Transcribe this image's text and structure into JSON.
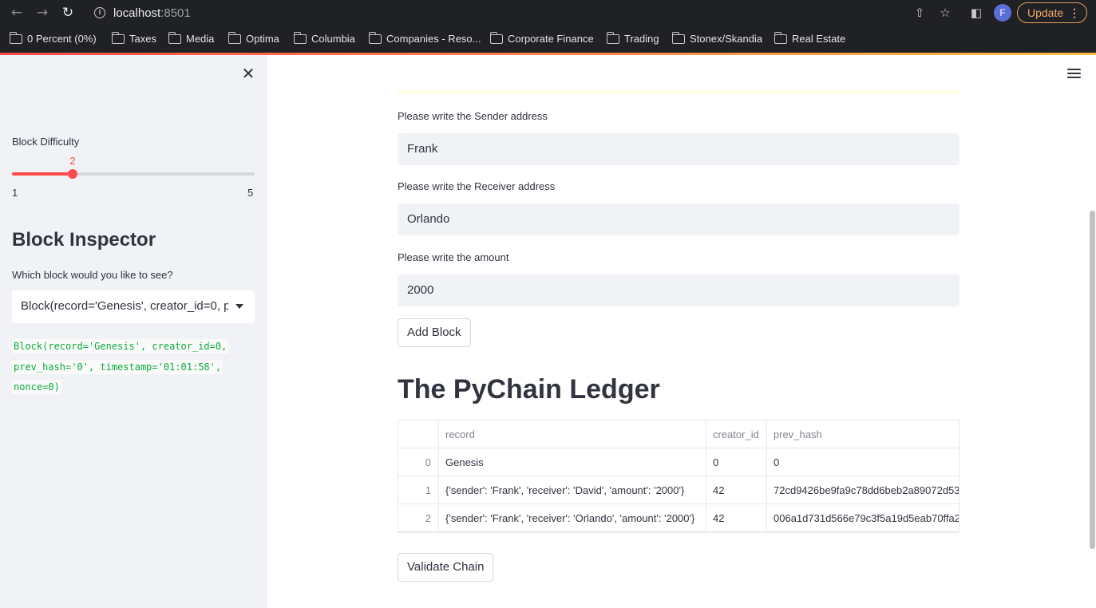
{
  "browser": {
    "url_host": "localhost",
    "url_port": ":8501",
    "profile_initial": "F",
    "update_label": "Update",
    "bookmarks": [
      "0 Percent (0%)",
      "Taxes",
      "Media",
      "Optima",
      "Columbia",
      "Companies - Reso...",
      "Corporate Finance",
      "Trading",
      "Stonex/Skandia",
      "Real Estate"
    ]
  },
  "sidebar": {
    "slider_label": "Block Difficulty",
    "slider_value": "2",
    "slider_min": "1",
    "slider_max": "5",
    "slider_fraction": 0.25,
    "heading": "Block Inspector",
    "select_label": "Which block would you like to see?",
    "select_value": "Block(record='Genesis', creator_id=0, prev_hash='0', timestamp='01:01:58', nonce=0)",
    "code_lines": [
      "Block(record='Genesis', creator_id=0,",
      "prev_hash='0', timestamp='01:01:58',",
      "nonce=0)"
    ]
  },
  "main": {
    "sender_label": "Please write the Sender address",
    "sender_value": "Frank",
    "receiver_label": "Please write the Receiver address",
    "receiver_value": "Orlando",
    "amount_label": "Please write the amount",
    "amount_value": "2000",
    "add_block_label": "Add Block",
    "ledger_title": "The PyChain Ledger",
    "validate_label": "Validate Chain",
    "table": {
      "columns": [
        "",
        "record",
        "creator_id",
        "prev_hash"
      ],
      "rows": [
        [
          "0",
          "Genesis",
          "0",
          "0"
        ],
        [
          "1",
          "{'sender': 'Frank', 'receiver': 'David', 'amount': '2000'}",
          "42",
          "72cd9426be9fa9c78dd6beb2a89072d53"
        ],
        [
          "2",
          "{'sender': 'Frank', 'receiver': 'Orlando', 'amount': '2000'}",
          "42",
          "006a1d731d566e79c3f5a19d5eab70ffa2"
        ]
      ]
    }
  }
}
